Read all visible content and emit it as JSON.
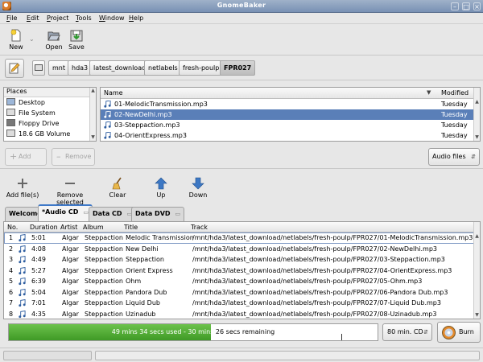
{
  "window": {
    "title": "GnomeBaker",
    "controls": [
      "minimize-icon",
      "maximize-icon",
      "close-icon"
    ]
  },
  "menu": [
    "File",
    "Edit",
    "Project",
    "Tools",
    "Window",
    "Help"
  ],
  "toolbar": {
    "new": "New",
    "open": "Open",
    "save": "Save"
  },
  "path": [
    "mnt",
    "hda3",
    "latest_download",
    "netlabels",
    "fresh-poulp",
    "FPR027"
  ],
  "places": {
    "header": "Places",
    "items": [
      {
        "label": "Desktop",
        "icon": "desktop-icon"
      },
      {
        "label": "File System",
        "icon": "harddisk-icon"
      },
      {
        "label": "Floppy Drive",
        "icon": "floppy-icon"
      },
      {
        "label": "18.6 GB Volume",
        "icon": "volume-icon"
      }
    ]
  },
  "files": {
    "columns": {
      "name": "Name",
      "modified": "Modified"
    },
    "rows": [
      {
        "name": "01-MelodicTransmission.mp3",
        "modified": "Tuesday",
        "selected": false
      },
      {
        "name": "02-NewDelhi.mp3",
        "modified": "Tuesday",
        "selected": true
      },
      {
        "name": "03-Steppaction.mp3",
        "modified": "Tuesday",
        "selected": false
      },
      {
        "name": "04-OrientExpress.mp3",
        "modified": "Tuesday",
        "selected": false
      }
    ]
  },
  "file_actions": {
    "add": "Add",
    "remove": "Remove",
    "filter": "Audio files"
  },
  "project_toolbar": {
    "add_files": "Add file(s)",
    "remove_selected": "Remove selected",
    "clear": "Clear",
    "up": "Up",
    "down": "Down"
  },
  "tabs": [
    "Welcome",
    "*Audio CD",
    "Data CD",
    "Data DVD"
  ],
  "tracks": {
    "columns": {
      "no": "No.",
      "duration": "Duration",
      "artist": "Artist",
      "album": "Album",
      "title": "Title",
      "track": "Track"
    },
    "rows": [
      {
        "no": "1",
        "duration": "5:01",
        "artist": "Algar",
        "album": "Steppaction",
        "title": "Melodic Transmission",
        "track": "/mnt/hda3/latest_download/netlabels/fresh-poulp/FPR027/01-MelodicTransmission.mp3"
      },
      {
        "no": "2",
        "duration": "4:08",
        "artist": "Algar",
        "album": "Steppaction",
        "title": "New Delhi",
        "track": "/mnt/hda3/latest_download/netlabels/fresh-poulp/FPR027/02-NewDelhi.mp3"
      },
      {
        "no": "3",
        "duration": "4:49",
        "artist": "Algar",
        "album": "Steppaction",
        "title": "Steppaction",
        "track": "/mnt/hda3/latest_download/netlabels/fresh-poulp/FPR027/03-Steppaction.mp3"
      },
      {
        "no": "4",
        "duration": "5:27",
        "artist": "Algar",
        "album": "Steppaction",
        "title": "Orient Express",
        "track": "/mnt/hda3/latest_download/netlabels/fresh-poulp/FPR027/04-OrientExpress.mp3"
      },
      {
        "no": "5",
        "duration": "6:39",
        "artist": "Algar",
        "album": "Steppaction",
        "title": "Ohm",
        "track": "/mnt/hda3/latest_download/netlabels/fresh-poulp/FPR027/05-Ohm.mp3"
      },
      {
        "no": "6",
        "duration": "5:04",
        "artist": "Algar",
        "album": "Steppaction",
        "title": "Pandora Dub",
        "track": "/mnt/hda3/latest_download/netlabels/fresh-poulp/FPR027/06-Pandora Dub.mp3"
      },
      {
        "no": "7",
        "duration": "7:01",
        "artist": "Algar",
        "album": "Steppaction",
        "title": "Liquid Dub",
        "track": "/mnt/hda3/latest_download/netlabels/fresh-poulp/FPR027/07-Liquid Dub.mp3"
      },
      {
        "no": "8",
        "duration": "4:35",
        "artist": "Algar",
        "album": "Steppaction",
        "title": "Uzinadub",
        "track": "/mnt/hda3/latest_download/netlabels/fresh-poulp/FPR027/08-Uzinadub.mp3"
      }
    ]
  },
  "status": {
    "used_text": "49 mins 34 secs used - 30 mins",
    "remaining_text": "26 secs remaining",
    "fill_fraction": 0.548,
    "disc_size": "80 min. CD",
    "burn": "Burn"
  },
  "colors": {
    "selection": "#5a7fb8",
    "progress_fill": "#4caf30",
    "titlebar": "#8aa0c0"
  }
}
